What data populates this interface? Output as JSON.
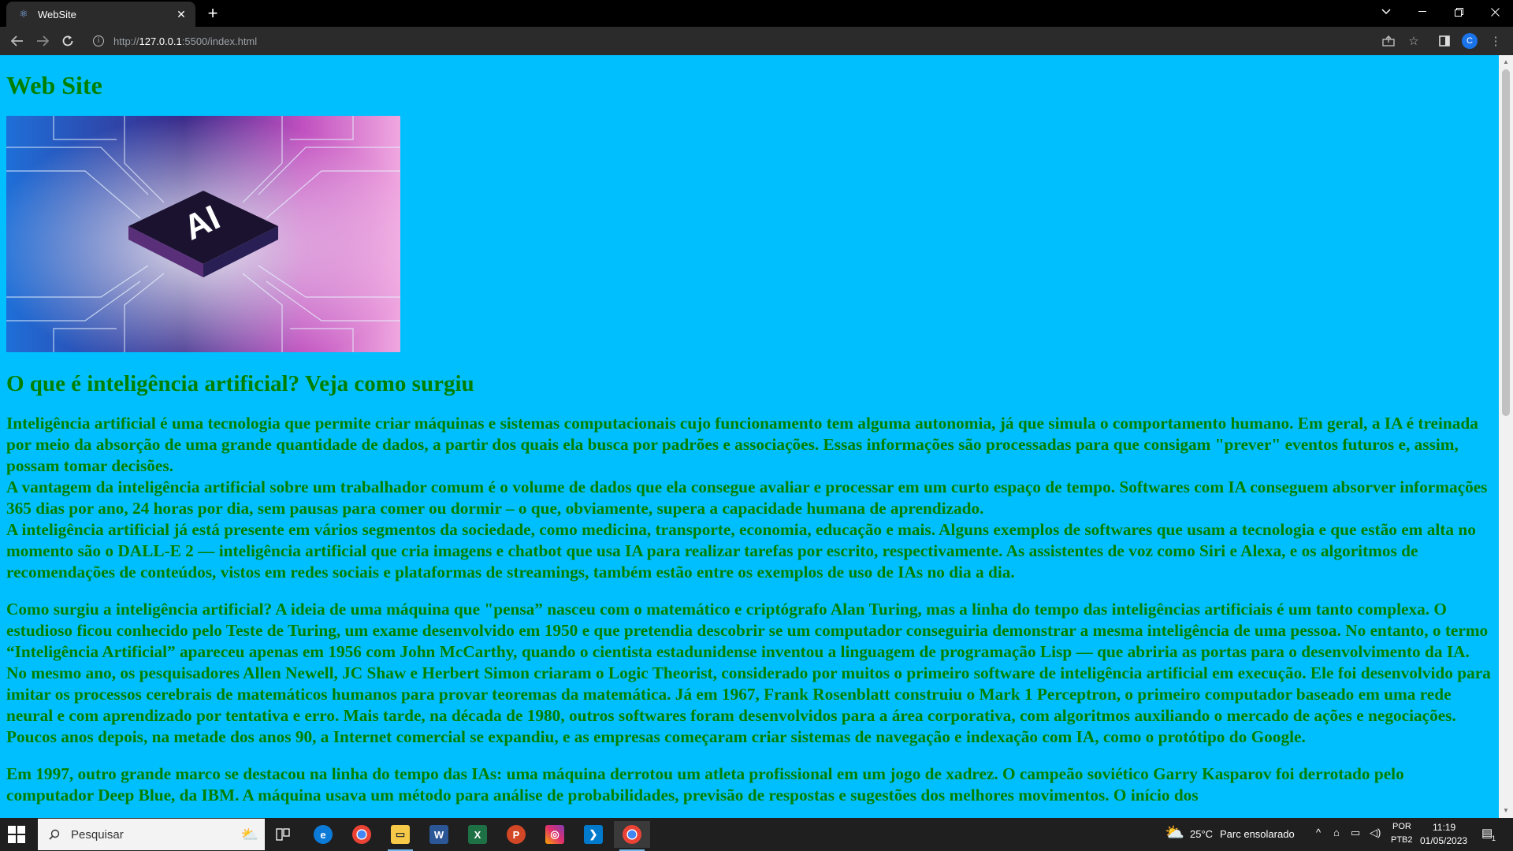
{
  "browser": {
    "tab_title": "WebSite",
    "url_prefix": "http://",
    "url_host": "127.0.0.1",
    "url_path": ":5500/index.html",
    "profile_initial": "C"
  },
  "page": {
    "site_title": "Web Site",
    "hero_image_text": "AI",
    "article_title": "O que é inteligência artificial? Veja como surgiu",
    "paragraphs": [
      "Inteligência artificial é uma tecnologia que permite criar máquinas e sistemas computacionais cujo funcionamento tem alguma autonomia, já que simula o comportamento humano. Em geral, a IA é treinada por meio da absorção de uma grande quantidade de dados, a partir dos quais ela busca por padrões e associações. Essas informações são processadas para que consigam \"prever\" eventos futuros e, assim, possam tomar decisões.",
      "A vantagem da inteligência artificial sobre um trabalhador comum é o volume de dados que ela consegue avaliar e processar em um curto espaço de tempo. Softwares com IA conseguem absorver informações 365 dias por ano, 24 horas por dia, sem pausas para comer ou dormir – o que, obviamente, supera a capacidade humana de aprendizado.",
      "A inteligência artificial já está presente em vários segmentos da sociedade, como medicina, transporte, economia, educação e mais. Alguns exemplos de softwares que usam a tecnologia e que estão em alta no momento são o DALL-E 2 — inteligência artificial que cria imagens e chatbot que usa IA para realizar tarefas por escrito, respectivamente. As assistentes de voz como Siri e Alexa, e os algoritmos de recomendações de conteúdos, vistos em redes sociais e plataformas de streamings, também estão entre os exemplos de uso de IAs no dia a dia.",
      "Como surgiu a inteligência artificial? A ideia de uma máquina que \"pensa” nasceu com o matemático e criptógrafo Alan Turing, mas a linha do tempo das inteligências artificiais é um tanto complexa. O estudioso ficou conhecido pelo Teste de Turing, um exame desenvolvido em 1950 e que pretendia descobrir se um computador conseguiria demonstrar a mesma inteligência de uma pessoa. No entanto, o termo “Inteligência Artificial” apareceu apenas em 1956 com John McCarthy, quando o cientista estadunidense inventou a linguagem de programação Lisp — que abriria as portas para o desenvolvimento da IA. No mesmo ano, os pesquisadores Allen Newell, JC Shaw e Herbert Simon criaram o Logic Theorist, considerado por muitos o primeiro software de inteligência artificial em execução. Ele foi desenvolvido para imitar os processos cerebrais de matemáticos humanos para provar teoremas da matemática. Já em 1967, Frank Rosenblatt construiu o Mark 1 Perceptron, o primeiro computador baseado em uma rede neural e com aprendizado por tentativa e erro. Mais tarde, na década de 1980, outros softwares foram desenvolvidos para a área corporativa, com algoritmos auxiliando o mercado de ações e negociações. Poucos anos depois, na metade dos anos 90, a Internet comercial se expandiu, e as empresas começaram criar sistemas de navegação e indexação com IA, como o protótipo do Google.",
      "Em 1997, outro grande marco se destacou na linha do tempo das IAs: uma máquina derrotou um atleta profissional em um jogo de xadrez. O campeão soviético Garry Kasparov foi derrotado pelo computador Deep Blue, da IBM. A máquina usava um método para análise de probabilidades, previsão de respostas e sugestões dos melhores movimentos. O início dos"
    ]
  },
  "taskbar": {
    "search_placeholder": "Pesquisar",
    "weather_temp": "25°C",
    "weather_desc": "Parc ensolarado",
    "lang_1": "POR",
    "lang_2": "PTB2",
    "time": "11:19",
    "date": "01/05/2023",
    "notif_count": "1"
  },
  "colors": {
    "page_bg": "#00bfff",
    "text": "#008000"
  }
}
